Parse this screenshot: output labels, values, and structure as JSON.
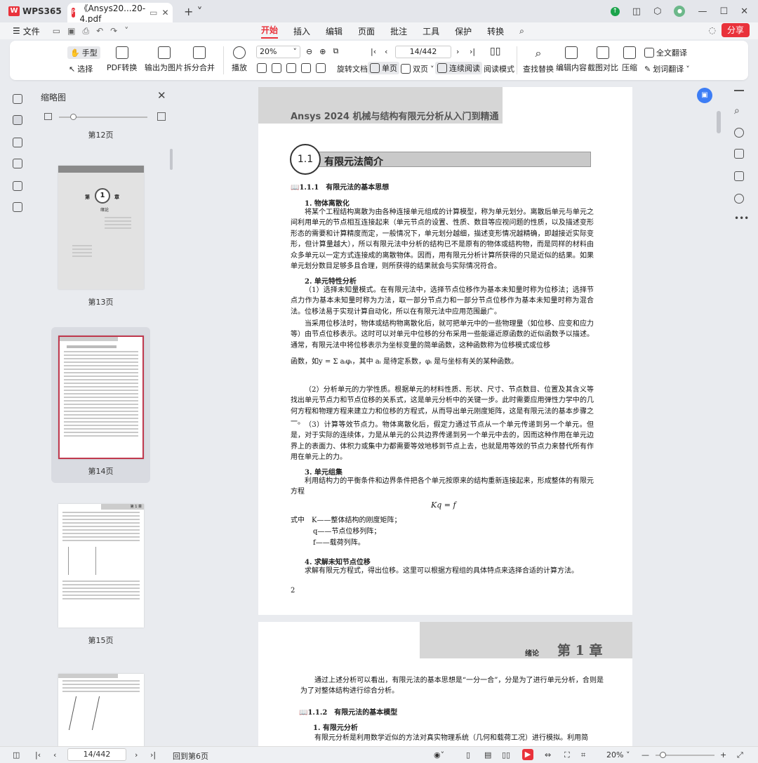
{
  "app": {
    "name": "WPS365"
  },
  "tab": {
    "title": "《Ansys20...20-4.pdf"
  },
  "menu": {
    "file": "文件",
    "tabs": [
      "开始",
      "插入",
      "编辑",
      "页面",
      "批注",
      "工具",
      "保护",
      "转换"
    ],
    "share": "分享"
  },
  "toolbar": {
    "hand": "手型",
    "select": "选择",
    "pdf_convert": "PDF转换",
    "to_image": "输出为图片",
    "split_merge": "拆分合并",
    "play": "播放",
    "zoom": "20%",
    "page": "14/442",
    "rotate": "旋转文档",
    "single": "单页",
    "double": "双页",
    "continuous": "连续阅读",
    "read_mode": "阅读模式",
    "find_replace": "查找替换",
    "edit_content": "编辑内容",
    "compare": "截图对比",
    "compress": "压缩",
    "full_translate": "全文翻译",
    "word_translate": "划词翻译"
  },
  "panel": {
    "title": "缩略图",
    "thumbs": [
      {
        "label": "第12页"
      },
      {
        "label": "第13页",
        "chapter_num": "1",
        "chapter_char_l": "第",
        "chapter_char_r": "章",
        "chapter_name": "绪论"
      },
      {
        "label": "第14页"
      },
      {
        "label": "第15页",
        "header": "第 1 章"
      },
      {
        "label": "第16页"
      }
    ]
  },
  "page14": {
    "header": "Ansys 2024 机械与结构有限元分析从入门到精通",
    "sec_num": "1.1",
    "sec_title": "有限元法简介",
    "sub1": "1.1.1　有限元法的基本思想",
    "h_1": "1. 物体离散化",
    "p_1": "将某个工程结构离散为由各种连接单元组成的计算模型，称为单元划分。离散后单元与单元之间利用单元的节点相互连接起来（单元节点的设置、性质、数目等应视问题的性质，以及描述变形形态的需要和计算精度而定，一般情况下，单元划分越细，描述变形情况越精确，即越接近实际变形，但计算量越大），所以有限元法中分析的结构已不是原有的物体或结构物，而是同样的材料由众多单元以一定方式连接成的离散物体。因而，用有限元分析计算所获得的只是近似的结果。如果单元划分数目足够多且合理，则所获得的结果就会与实际情况符合。",
    "h_2": "2. 单元特性分析",
    "p_2": "（1）选择未知量模式。在有限元法中，选择节点位移作为基本未知量时称为位移法；选择节点力作为基本未知量时称为力法，取一部分节点力和一部分节点位移作为基本未知量时称为混合法。位移法易于实现计算自动化，所以在有限元法中应用范围最广。",
    "p_3": "当采用位移法时，物体或结构物离散化后，就可把单元中的一些物理量（如位移、应变和应力等）由节点位移表示。这时可以对单元中位移的分布采用一些能逼近原函数的近似函数予以描述。通常，有限元法中将位移表示为坐标变量的简单函数，这种函数称为位移模式或位移",
    "p_3b": "函数，如y = Σ aᵢφᵢ，其中 aᵢ 是待定系数，φᵢ 是与坐标有关的某种函数。",
    "p_4": "（2）分析单元的力学性质。根据单元的材料性质、形状、尺寸、节点数目、位置及其含义等找出单元节点力和节点位移的关系式，这是单元分析中的关键一步。此时需要应用弹性力学中的几何方程和物理方程来建立力和位移的方程式，从而导出单元刚度矩阵，这是有限元法的基本步骤之一。",
    "p_5": "（3）计算等效节点力。物体离散化后，假定力通过节点从一个单元传递到另一个单元。但是，对于实际的连续体，力是从单元的公共边界传递到另一个单元中去的，因而这种作用在单元边界上的表面力、体积力或集中力都需要等效地移到节点上去，也就是用等效的节点力来替代所有作用在单元上的力。",
    "h_3": "3. 单元组集",
    "p_6": "利用结构力的平衡条件和边界条件把各个单元按原来的结构重新连接起来，形成整体的有限元方程",
    "formula": "Kq = f",
    "where_1": "式中　K——整体结构的刚度矩阵；",
    "where_2": "q——节点位移列阵；",
    "where_3": "f——载荷列阵。",
    "h_4": "4. 求解未知节点位移",
    "p_7": "求解有限元方程式，得出位移。这里可以根据方程组的具体特点来选择合适的计算方法。",
    "page_num": "2"
  },
  "page15": {
    "chapter_label": "绪论",
    "chapter": "第 1 章",
    "p_1": "通过上述分析可以看出，有限元法的基本思想是“一分一合”，分是为了进行单元分析，合则是为了对整体结构进行综合分析。",
    "sub2": "1.1.2　有限元法的基本模型",
    "h_1": "1. 有限元分析",
    "p_2": "有限元分析是利用数学近似的方法对真实物理系统（几何和载荷工况）进行模拟。利用简"
  },
  "status": {
    "page": "14/442",
    "back": "回到第6页",
    "zoom": "20%"
  }
}
